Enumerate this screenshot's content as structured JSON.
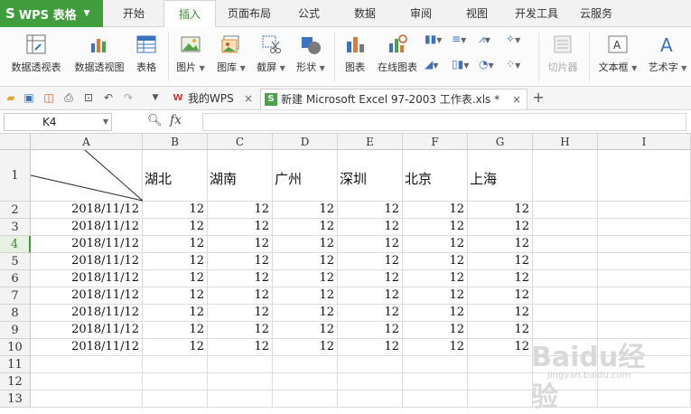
{
  "app": {
    "name": "WPS 表格"
  },
  "menu": {
    "tabs": [
      {
        "label": "开始"
      },
      {
        "label": "插入"
      },
      {
        "label": "页面布局"
      },
      {
        "label": "公式"
      },
      {
        "label": "数据"
      },
      {
        "label": "审阅"
      },
      {
        "label": "视图"
      },
      {
        "label": "开发工具"
      },
      {
        "label": "云服务"
      }
    ],
    "active": "插入"
  },
  "ribbon": {
    "pivot_table": "数据透视表",
    "pivot_chart": "数据透视图",
    "table": "表格",
    "picture": "图片",
    "gallery": "图库",
    "screenshot": "截屏",
    "shape": "形状",
    "chart": "图表",
    "online_chart": "在线图表",
    "slicer": "切片器",
    "textbox": "文本框",
    "wordart": "艺术字"
  },
  "doc_tabs": [
    {
      "label": "我的WPS"
    },
    {
      "label": "新建 Microsoft Excel 97-2003 工作表.xls *"
    }
  ],
  "formula_bar": {
    "name_box": "K4",
    "fx": "fx",
    "value": ""
  },
  "sheet": {
    "columns": [
      "A",
      "B",
      "C",
      "D",
      "E",
      "F",
      "G",
      "H",
      "I"
    ],
    "rows": [
      "1",
      "2",
      "3",
      "4",
      "5",
      "6",
      "7",
      "8",
      "9",
      "10",
      "11",
      "12",
      "13"
    ],
    "selected_row": "4",
    "header_row": [
      "湖北",
      "湖南",
      "广州",
      "深圳",
      "北京",
      "上海"
    ],
    "data_rows": [
      {
        "date": "2018/11/12",
        "values": [
          "12",
          "12",
          "12",
          "12",
          "12",
          "12"
        ]
      },
      {
        "date": "2018/11/12",
        "values": [
          "12",
          "12",
          "12",
          "12",
          "12",
          "12"
        ]
      },
      {
        "date": "2018/11/12",
        "values": [
          "12",
          "12",
          "12",
          "12",
          "12",
          "12"
        ]
      },
      {
        "date": "2018/11/12",
        "values": [
          "12",
          "12",
          "12",
          "12",
          "12",
          "12"
        ]
      },
      {
        "date": "2018/11/12",
        "values": [
          "12",
          "12",
          "12",
          "12",
          "12",
          "12"
        ]
      },
      {
        "date": "2018/11/12",
        "values": [
          "12",
          "12",
          "12",
          "12",
          "12",
          "12"
        ]
      },
      {
        "date": "2018/11/12",
        "values": [
          "12",
          "12",
          "12",
          "12",
          "12",
          "12"
        ]
      },
      {
        "date": "2018/11/12",
        "values": [
          "12",
          "12",
          "12",
          "12",
          "12",
          "12"
        ]
      },
      {
        "date": "2018/11/12",
        "values": [
          "12",
          "12",
          "12",
          "12",
          "12",
          "12"
        ]
      }
    ]
  },
  "watermark": {
    "text": "Baidu经验",
    "sub": "jingyan.baidu.com"
  }
}
